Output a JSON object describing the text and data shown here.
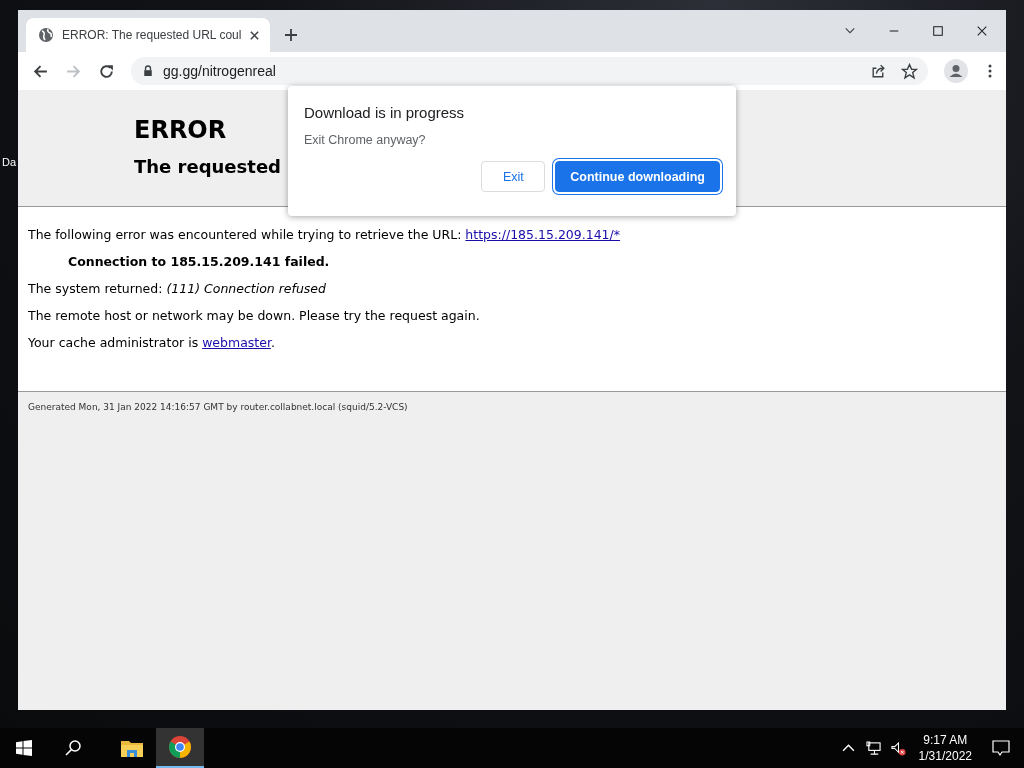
{
  "desktop": {
    "icon_labels": [
      "Da"
    ]
  },
  "browser": {
    "tabs": [
      {
        "title": "ERROR: The requested URL coul",
        "selected": true
      }
    ],
    "address": "gg.gg/nitrogenreal",
    "page": {
      "heading": "ERROR",
      "subheading": "The requested",
      "intro": {
        "text": "The following error was encountered while trying to retrieve the URL:",
        "link": "https://185.15.209.141/*"
      },
      "detail": "Connection to 185.15.209.141 failed.",
      "returned": "The system returned: *(111) Connection refused*",
      "advice": "The remote host or network may be down. Please try the request again.",
      "admin": {
        "text": "Your cache administrator is",
        "link": "webmaster",
        "after": "."
      },
      "footer": "Generated Mon, 31 Jan 2022 14:16:57 GMT by router.collabnet.local (squid/5.2-VCS)"
    },
    "dialog": {
      "title": "Download is in progress",
      "message": "Exit Chrome anyway?",
      "buttons": [
        {
          "label": "Exit",
          "kind": "secondary"
        },
        {
          "label": "Continue downloading",
          "kind": "primary"
        }
      ]
    }
  },
  "taskbar": {
    "apps": [
      {
        "kind": "folder",
        "selected": false
      },
      {
        "kind": "chrome",
        "selected": true
      }
    ],
    "time": "9:17 AM",
    "date": "1/31/2022"
  }
}
